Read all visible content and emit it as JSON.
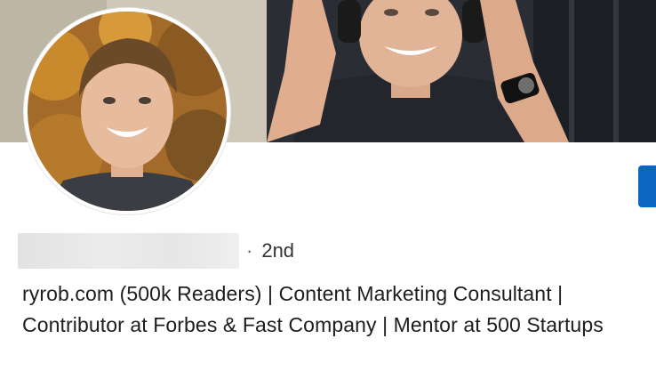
{
  "profile": {
    "name_redacted": true,
    "separator": "·",
    "connection_degree": "2nd",
    "headline": "ryrob.com (500k Readers) | Content Marketing Consultant | Contributor at Forbes & Fast Company | Mentor at 500 Startups"
  },
  "colors": {
    "primary_button": "#0a66c2",
    "text_primary": "#1d1d1d",
    "text_secondary": "#5a5a5a"
  },
  "images": {
    "cover": "cover-photo-man-with-headphones",
    "avatar": "profile-photo-smiling-man"
  }
}
